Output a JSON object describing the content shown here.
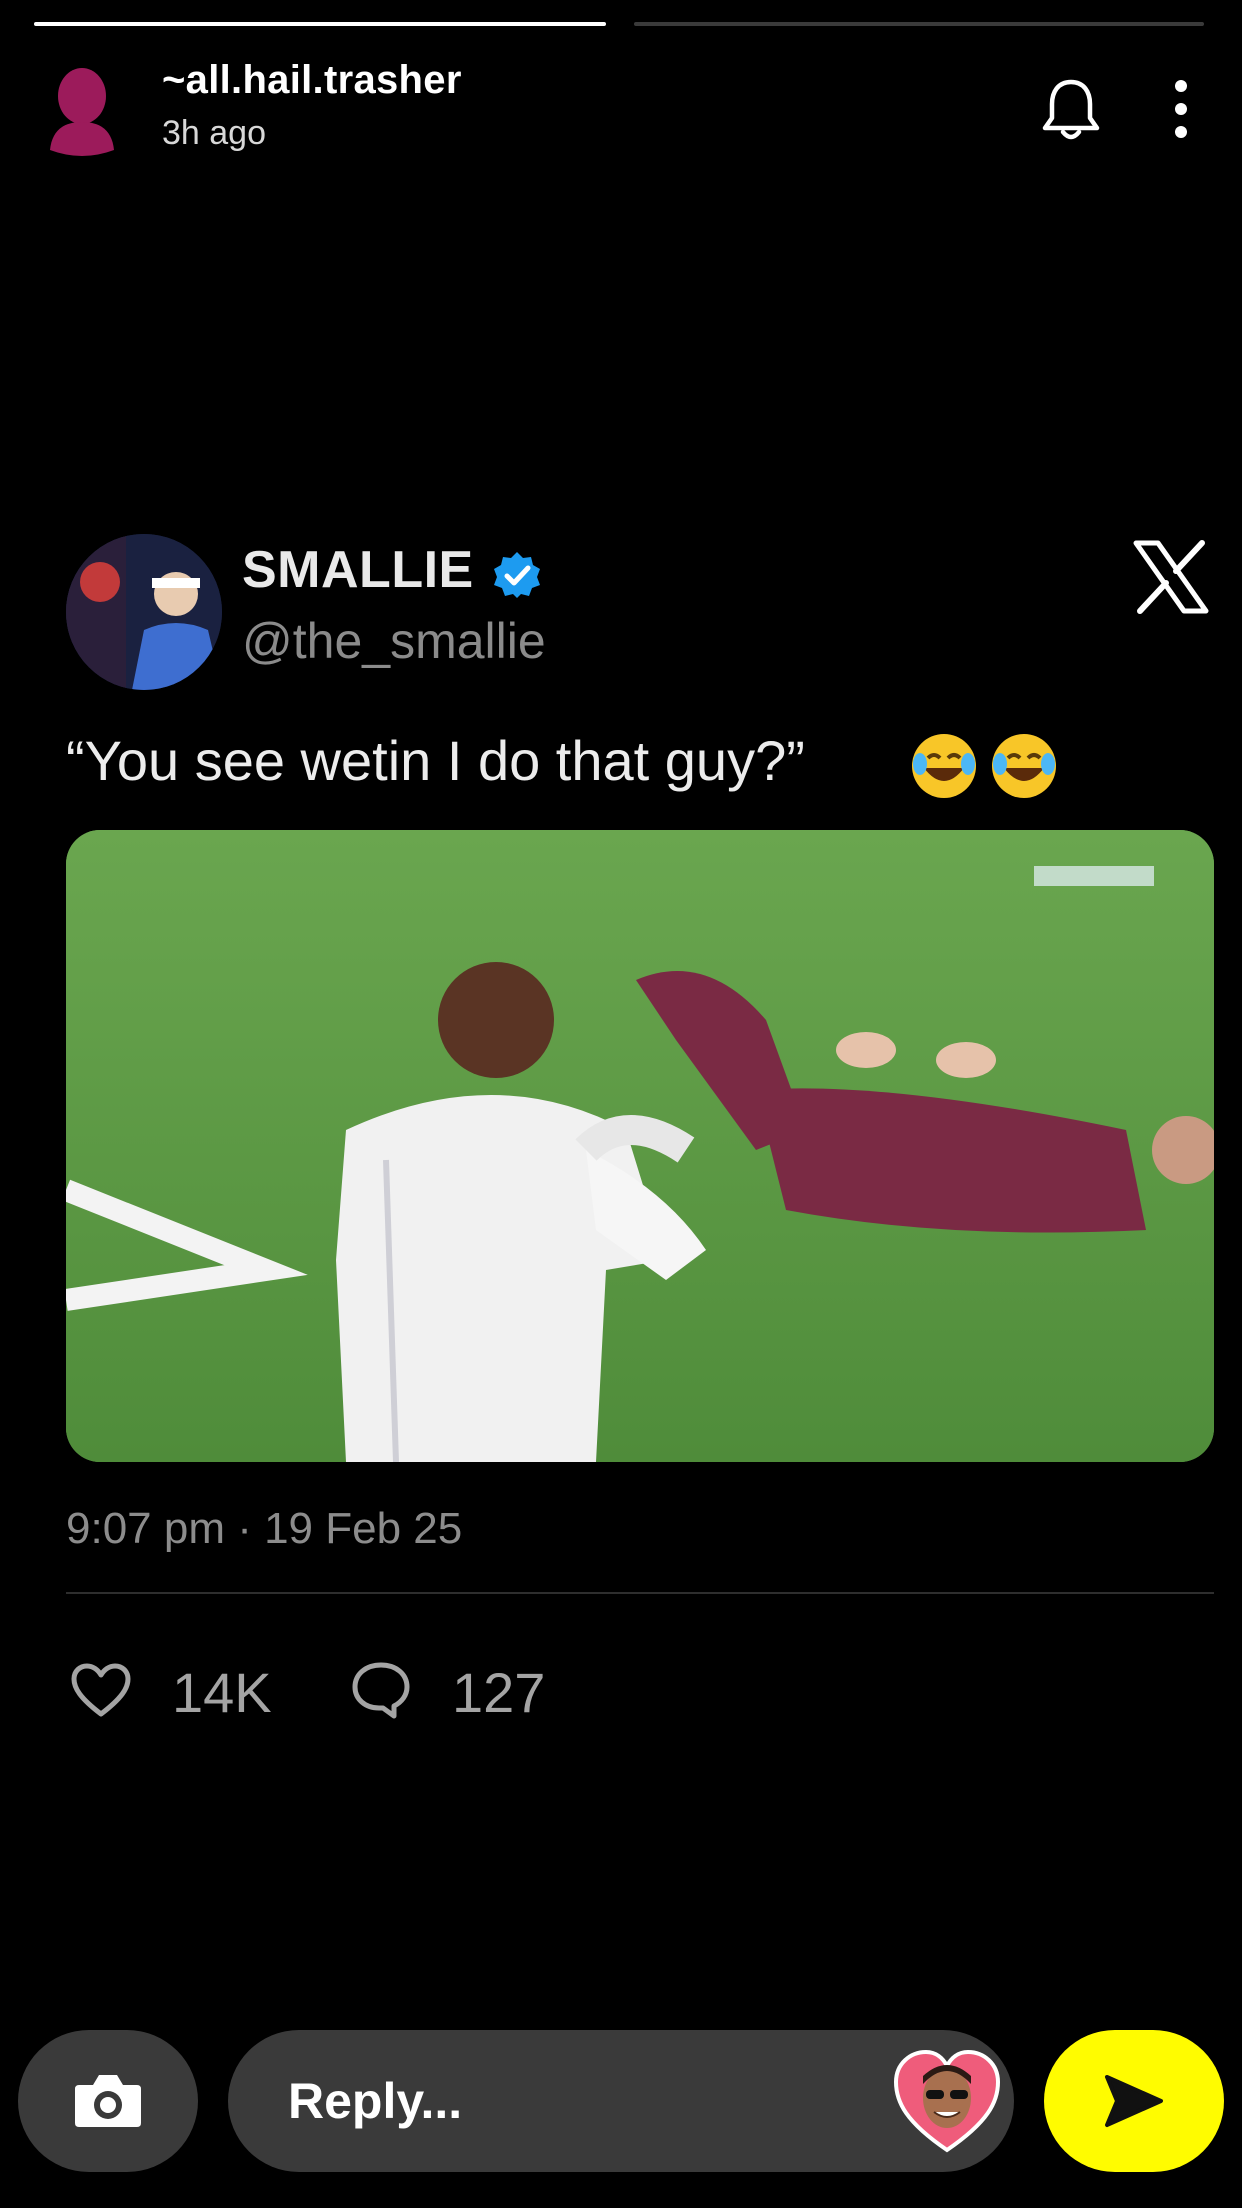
{
  "story": {
    "progress": [
      1.0,
      0.0
    ],
    "username": "~all.hail.trasher",
    "time": "3h ago",
    "avatar_icon": "person-silhouette-icon",
    "avatar_color": "#9c1b5b"
  },
  "tweet": {
    "name": "SMALLIE",
    "handle": "@the_smallie",
    "text": "“You see wetin I do that guy?”",
    "emoji": "😂😂",
    "date": "9:07 pm · 19 Feb 25",
    "likes": "14K",
    "replies": "127",
    "verified_color": "#1d9bf0"
  },
  "composer": {
    "placeholder": "Reply...",
    "send_color": "#fffc00"
  }
}
